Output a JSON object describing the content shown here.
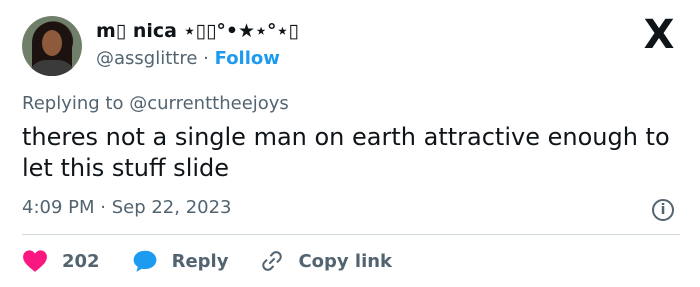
{
  "author": {
    "display_name": "m▯ nica ⋆▯▯°•★⋆°⋆▯",
    "handle": "@assglittre",
    "separator": "·",
    "follow_label": "Follow"
  },
  "brand": {
    "logo_text": "X"
  },
  "reply": {
    "prefix": "Replying to",
    "mention": "@currenttheejoys"
  },
  "tweet": {
    "text": "theres not a single man on earth attractive enough to let this stuff slide",
    "timestamp": "4:09 PM · Sep 22, 2023"
  },
  "actions": {
    "like_count": "202",
    "reply_label": "Reply",
    "copy_label": "Copy link"
  },
  "colors": {
    "heart": "#f91880",
    "reply_bubble": "#1d9bf0",
    "link_accent": "#1d9bf0",
    "secondary_text": "#536471"
  },
  "icons": {
    "info": "i"
  }
}
